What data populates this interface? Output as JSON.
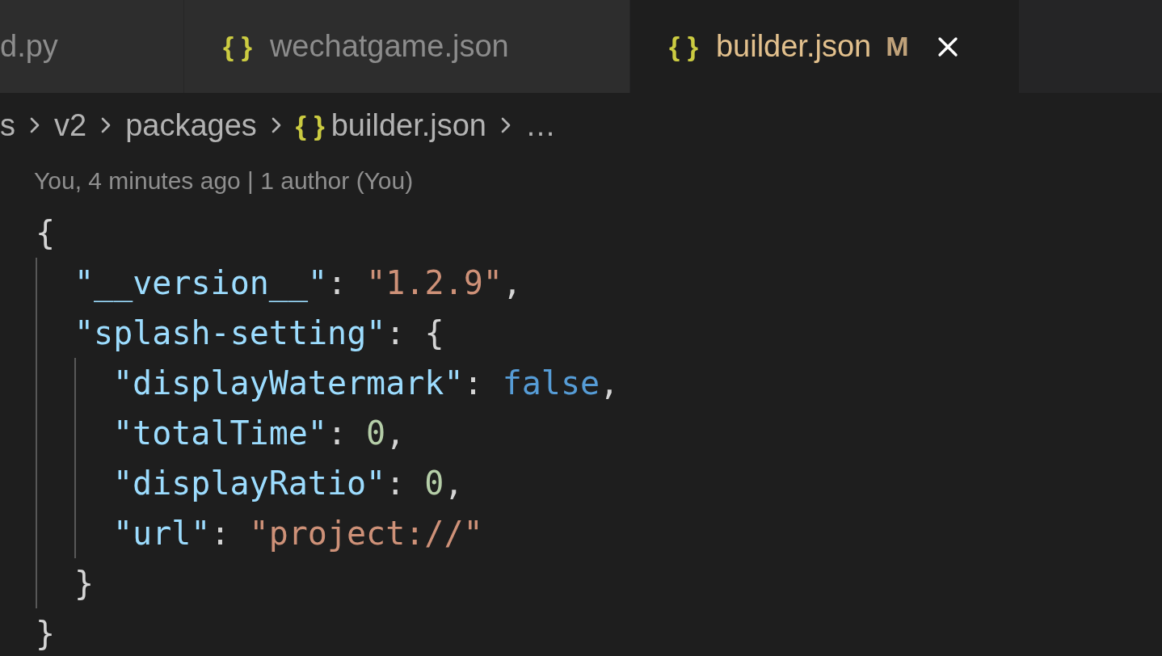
{
  "tabs": [
    {
      "label": "d.py",
      "selected": false,
      "closable": false
    },
    {
      "icon": "{ }",
      "label": "wechatgame.json",
      "selected": false,
      "closable": false
    },
    {
      "icon": "{ }",
      "label": "builder.json",
      "selected": true,
      "modified": "M",
      "closable": true
    }
  ],
  "breadcrumb": [
    {
      "text": "s"
    },
    {
      "text": "v2"
    },
    {
      "text": "packages"
    },
    {
      "icon": "{ }",
      "text": "builder.json"
    },
    {
      "text": "…"
    }
  ],
  "blame": "You, 4 minutes ago | 1 author (You)",
  "code": [
    {
      "tokens": [
        {
          "kind": "punct",
          "text": "{"
        }
      ],
      "children": [
        {
          "tokens": [
            {
              "kind": "key",
              "text": "\"__version__\""
            },
            {
              "kind": "punct",
              "text": ": "
            },
            {
              "kind": "string",
              "text": "\"1.2.9\""
            },
            {
              "kind": "punct",
              "text": ","
            }
          ]
        },
        {
          "tokens": [
            {
              "kind": "key",
              "text": "\"splash-setting\""
            },
            {
              "kind": "punct",
              "text": ": {"
            }
          ],
          "children": [
            {
              "tokens": [
                {
                  "kind": "key",
                  "text": "\"displayWatermark\""
                },
                {
                  "kind": "punct",
                  "text": ": "
                },
                {
                  "kind": "boolean",
                  "text": "false"
                },
                {
                  "kind": "punct",
                  "text": ","
                }
              ]
            },
            {
              "tokens": [
                {
                  "kind": "key",
                  "text": "\"totalTime\""
                },
                {
                  "kind": "punct",
                  "text": ": "
                },
                {
                  "kind": "number",
                  "text": "0"
                },
                {
                  "kind": "punct",
                  "text": ","
                }
              ]
            },
            {
              "tokens": [
                {
                  "kind": "key",
                  "text": "\"displayRatio\""
                },
                {
                  "kind": "punct",
                  "text": ": "
                },
                {
                  "kind": "number",
                  "text": "0"
                },
                {
                  "kind": "punct",
                  "text": ","
                }
              ]
            },
            {
              "tokens": [
                {
                  "kind": "key",
                  "text": "\"url\""
                },
                {
                  "kind": "punct",
                  "text": ": "
                },
                {
                  "kind": "string",
                  "text": "\"project://\""
                }
              ]
            }
          ]
        },
        {
          "tokens": [
            {
              "kind": "punct",
              "text": "}"
            }
          ]
        }
      ]
    },
    {
      "tokens": [
        {
          "kind": "punct",
          "text": "}"
        }
      ]
    }
  ]
}
